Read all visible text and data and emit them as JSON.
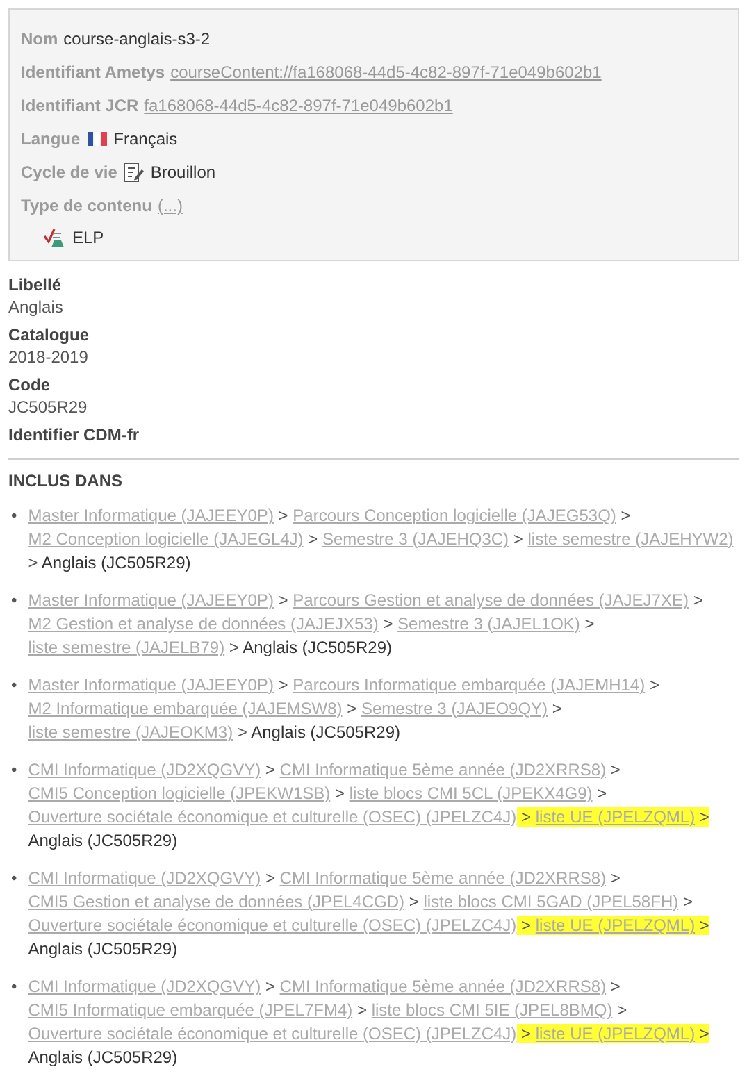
{
  "properties": [
    {
      "label": "Nom",
      "value": "course-anglais-s3-2",
      "kind": "text"
    },
    {
      "label": "Identifiant Ametys",
      "value": "courseContent://fa168068-44d5-4c82-897f-71e049b602b1",
      "kind": "link"
    },
    {
      "label": "Identifiant JCR",
      "value": "fa168068-44d5-4c82-897f-71e049b602b1",
      "kind": "link"
    },
    {
      "label": "Langue",
      "value": "Français",
      "kind": "flag"
    },
    {
      "label": "Cycle de vie",
      "value": "Brouillon",
      "kind": "status"
    },
    {
      "label": "Type de contenu",
      "value": "(...)",
      "kind": "link"
    }
  ],
  "content_type": {
    "label": "ELP"
  },
  "fields": [
    {
      "label": "Libellé",
      "value": "Anglais"
    },
    {
      "label": "Catalogue",
      "value": "2018-2019"
    },
    {
      "label": "Code",
      "value": "JC505R29"
    },
    {
      "label": "Identifier CDM-fr"
    }
  ],
  "included_in": {
    "title": "INCLUS DANS",
    "separator": ">",
    "bullet": "•",
    "paths": [
      {
        "crumbs": [
          {
            "text": "Master Informatique (JAJEEY0P)",
            "kind": "link",
            "highlighted": false
          },
          {
            "text": "Parcours Conception logicielle (JAJEG53Q)",
            "kind": "link",
            "highlighted": false
          },
          {
            "text": "M2 Conception logicielle (JAJEGL4J)",
            "kind": "link",
            "highlighted": false
          },
          {
            "text": "Semestre 3 (JAJEHQ3C)",
            "kind": "link",
            "highlighted": false
          },
          {
            "text": "liste semestre (JAJEHYW2)",
            "kind": "link",
            "highlighted": false
          },
          {
            "text": "Anglais (JC505R29)",
            "kind": "current",
            "highlighted": false
          }
        ]
      },
      {
        "crumbs": [
          {
            "text": "Master Informatique (JAJEEY0P)",
            "kind": "link",
            "highlighted": false
          },
          {
            "text": "Parcours Gestion et analyse de données (JAJEJ7XE)",
            "kind": "link",
            "highlighted": false
          },
          {
            "text": "M2 Gestion et analyse de données (JAJEJX53)",
            "kind": "link",
            "highlighted": false
          },
          {
            "text": "Semestre 3 (JAJEL1OK)",
            "kind": "link",
            "highlighted": false
          },
          {
            "text": "liste semestre (JAJELB79)",
            "kind": "link",
            "highlighted": false
          },
          {
            "text": "Anglais (JC505R29)",
            "kind": "current",
            "highlighted": false
          }
        ]
      },
      {
        "crumbs": [
          {
            "text": "Master Informatique (JAJEEY0P)",
            "kind": "link",
            "highlighted": false
          },
          {
            "text": "Parcours Informatique embarquée (JAJEMH14)",
            "kind": "link",
            "highlighted": false
          },
          {
            "text": "M2 Informatique embarquée (JAJEMSW8)",
            "kind": "link",
            "highlighted": false
          },
          {
            "text": "Semestre 3 (JAJEO9QY)",
            "kind": "link",
            "highlighted": false
          },
          {
            "text": "liste semestre (JAJEOKM3)",
            "kind": "link",
            "highlighted": false
          },
          {
            "text": "Anglais (JC505R29)",
            "kind": "current",
            "highlighted": false
          }
        ]
      },
      {
        "crumbs": [
          {
            "text": "CMI Informatique (JD2XQGVY)",
            "kind": "link",
            "highlighted": false
          },
          {
            "text": "CMI Informatique 5ème année (JD2XRRS8)",
            "kind": "link",
            "highlighted": false
          },
          {
            "text": "CMI5 Conception logicielle (JPEKW1SB)",
            "kind": "link",
            "highlighted": false
          },
          {
            "text": "liste blocs CMI 5CL (JPEKX4G9)",
            "kind": "link",
            "highlighted": false
          },
          {
            "text": "Ouverture sociétale économique et culturelle (OSEC) (JPELZC4J)",
            "kind": "link",
            "highlighted": false
          },
          {
            "text": "liste UE (JPELZQML)",
            "kind": "link",
            "highlighted": true
          },
          {
            "text": "Anglais (JC505R29)",
            "kind": "current",
            "highlighted": false
          }
        ]
      },
      {
        "crumbs": [
          {
            "text": "CMI Informatique (JD2XQGVY)",
            "kind": "link",
            "highlighted": false
          },
          {
            "text": "CMI Informatique 5ème année (JD2XRRS8)",
            "kind": "link",
            "highlighted": false
          },
          {
            "text": "CMI5 Gestion et analyse de données (JPEL4CGD)",
            "kind": "link",
            "highlighted": false
          },
          {
            "text": "liste blocs CMI 5GAD (JPEL58FH)",
            "kind": "link",
            "highlighted": false
          },
          {
            "text": "Ouverture sociétale économique et culturelle (OSEC) (JPELZC4J)",
            "kind": "link",
            "highlighted": false
          },
          {
            "text": "liste UE (JPELZQML)",
            "kind": "link",
            "highlighted": true
          },
          {
            "text": "Anglais (JC505R29)",
            "kind": "current",
            "highlighted": false
          }
        ]
      },
      {
        "crumbs": [
          {
            "text": "CMI Informatique (JD2XQGVY)",
            "kind": "link",
            "highlighted": false
          },
          {
            "text": "CMI Informatique 5ème année (JD2XRRS8)",
            "kind": "link",
            "highlighted": false
          },
          {
            "text": "CMI5 Informatique embarquée (JPEL7FM4)",
            "kind": "link",
            "highlighted": false
          },
          {
            "text": "liste blocs CMI 5IE (JPEL8BMQ)",
            "kind": "link",
            "highlighted": false
          },
          {
            "text": "Ouverture sociétale économique et culturelle (OSEC) (JPELZC4J)",
            "kind": "link",
            "highlighted": false
          },
          {
            "text": "liste UE (JPELZQML)",
            "kind": "link",
            "highlighted": true
          },
          {
            "text": "Anglais (JC505R29)",
            "kind": "current",
            "highlighted": false
          }
        ]
      }
    ]
  }
}
